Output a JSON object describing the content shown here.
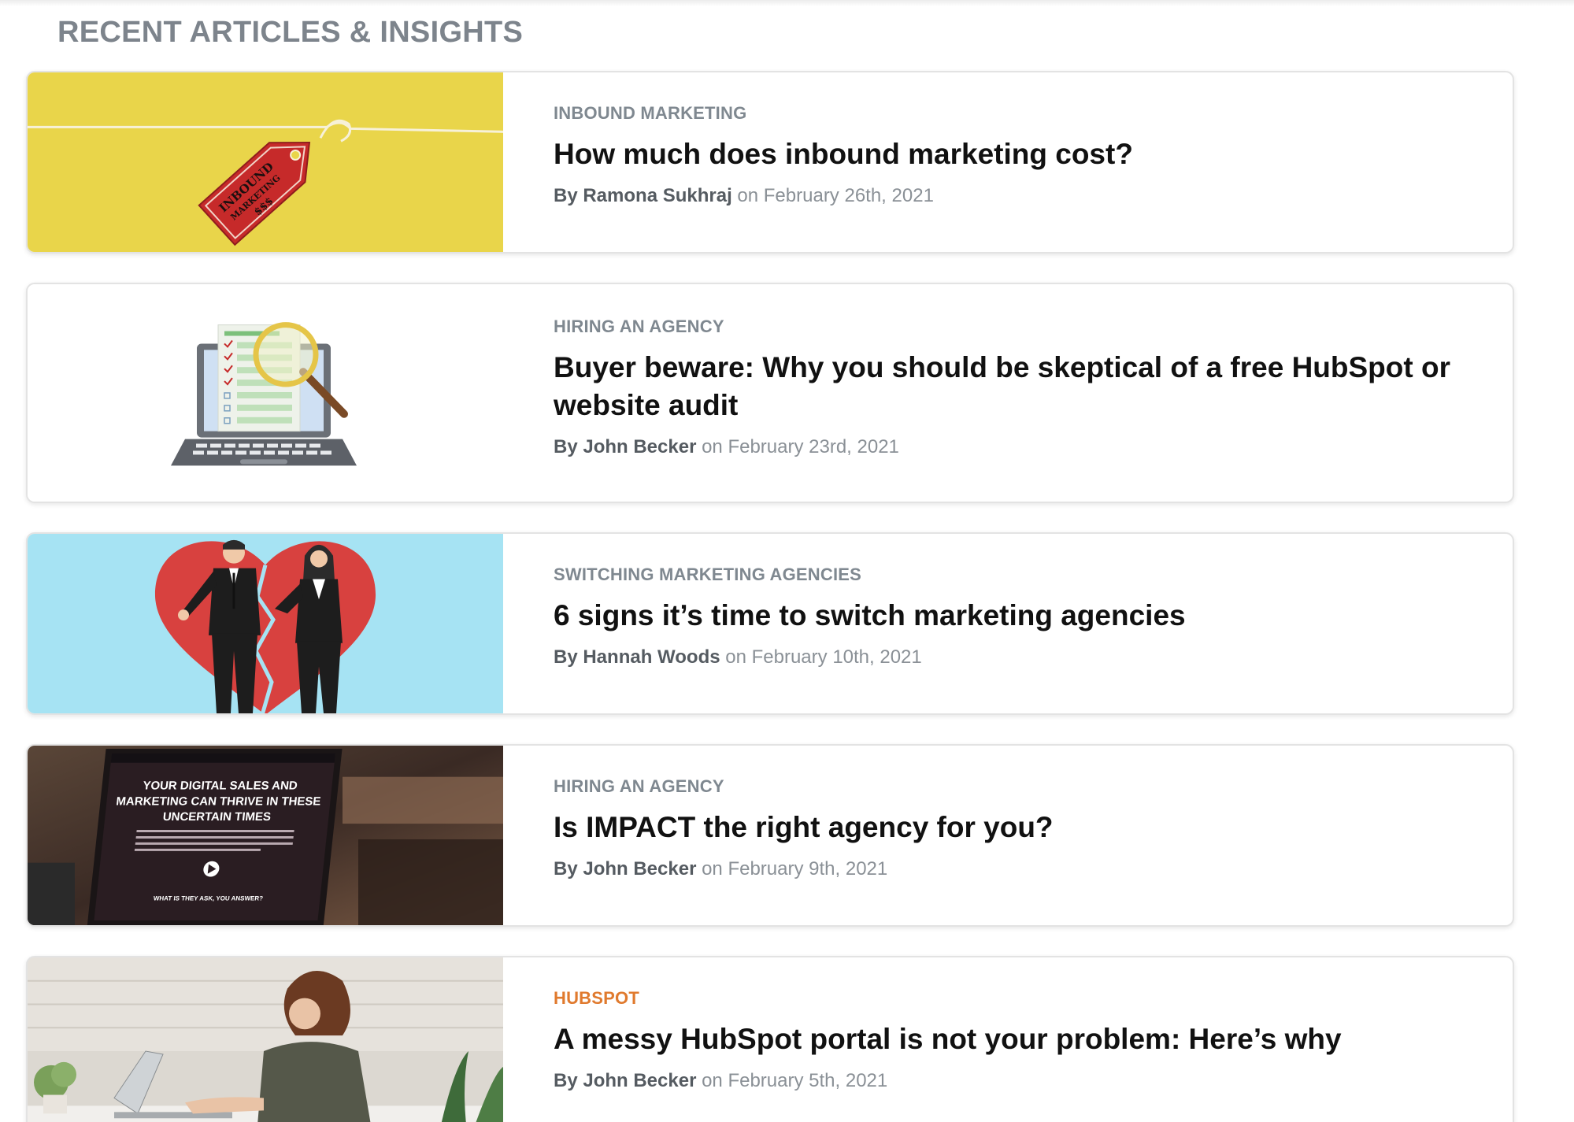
{
  "section": {
    "title": "RECENT ARTICLES & INSIGHTS"
  },
  "articles": [
    {
      "category": "INBOUND MARKETING",
      "title": "How much does inbound marketing cost?",
      "by": "By Ramona Sukhraj",
      "date": "on February 26th, 2021",
      "thumb": {
        "bg": "#e9d54a",
        "tag_text_1": "INBOUND",
        "tag_text_2": "MARKETING",
        "tag_text_3": "$$$"
      }
    },
    {
      "category": "HIRING AN AGENCY",
      "title": "Buyer beware: Why you should be skeptical of a free HubSpot or website audit",
      "by": "By John Becker",
      "date": "on February 23rd, 2021",
      "thumb": {
        "bg": "#ffffff"
      }
    },
    {
      "category": "SWITCHING MARKETING AGENCIES",
      "title": "6 signs it’s time to switch marketing agencies",
      "by": "By Hannah Woods",
      "date": "on February 10th, 2021",
      "thumb": {
        "bg": "#a6e3f3"
      }
    },
    {
      "category": "HIRING AN AGENCY",
      "title": "Is IMPACT the right agency for you?",
      "by": "By John Becker",
      "date": "on February 9th, 2021",
      "thumb": {
        "bg": "#3a2a24",
        "screen_line_1": "YOUR DIGITAL SALES AND",
        "screen_line_2": "MARKETING CAN THRIVE IN THESE",
        "screen_line_3": "UNCERTAIN TIMES",
        "screen_sub": "WHAT IS THEY ASK, YOU ANSWER?"
      }
    },
    {
      "category": "HUBSPOT",
      "category_color": "#e07a2e",
      "title": "A messy HubSpot portal is not your problem: Here’s why",
      "by": "By John Becker",
      "date": "on February 5th, 2021",
      "thumb": {
        "bg": "#d9d4cc"
      }
    }
  ]
}
